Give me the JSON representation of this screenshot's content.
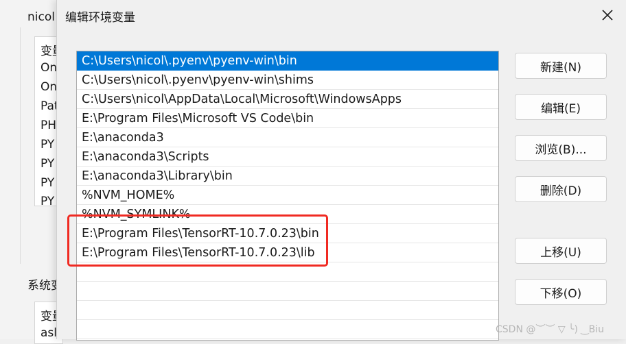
{
  "background_window": {
    "user_section_label": "nicol",
    "user_vars": {
      "header": "变量",
      "rows": [
        "On",
        "On",
        "Pat",
        "PH",
        "PY",
        "PY",
        "PY",
        "PY"
      ]
    },
    "system_section_label": "系统变",
    "system_vars": {
      "header": "变量",
      "rows": [
        "asl"
      ]
    }
  },
  "dialog": {
    "title": "编辑环境变量",
    "close_glyph": "✕",
    "paths": [
      "C:\\Users\\nicol\\.pyenv\\pyenv-win\\bin",
      "C:\\Users\\nicol\\.pyenv\\pyenv-win\\shims",
      "C:\\Users\\nicol\\AppData\\Local\\Microsoft\\WindowsApps",
      "E:\\Program Files\\Microsoft VS Code\\bin",
      "E:\\anaconda3",
      "E:\\anaconda3\\Scripts",
      "E:\\anaconda3\\Library\\bin",
      "%NVM_HOME%",
      "%NVM_SYMLINK%",
      "E:\\Program Files\\TensorRT-10.7.0.23\\bin",
      "E:\\Program Files\\TensorRT-10.7.0.23\\lib"
    ],
    "selected_index": 0,
    "buttons": {
      "new": "新建(N)",
      "edit": "编辑(E)",
      "browse": "浏览(B)...",
      "delete": "删除(D)",
      "move_up": "上移(U)",
      "move_down": "下移(O)"
    }
  },
  "watermark": "CSDN @︶︶ ▽ ╰) ‿Biu",
  "colors": {
    "selection": "#0078d7",
    "highlight_box": "#f02a22"
  }
}
